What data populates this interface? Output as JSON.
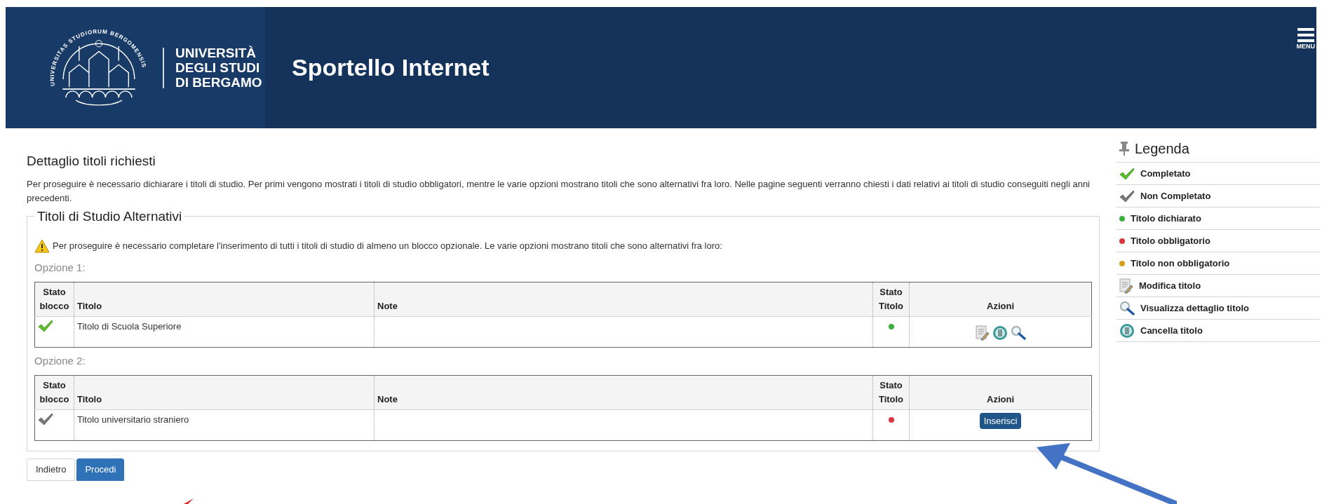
{
  "header": {
    "logo_lines": [
      "UNIVERSITÀ",
      "DEGLI STUDI",
      "DI BERGAMO"
    ],
    "seal_text": "UNIVERSITAS STUDIORUM BERGOMENSIS",
    "title": "Sportello Internet",
    "menu_label": "MENU"
  },
  "page": {
    "title": "Dettaglio titoli richiesti",
    "intro": "Per proseguire è necessario dichiarare i titoli di studio. Per primi vengono mostrati i titoli di studio obbligatori, mentre le varie opzioni mostrano titoli che sono alternativi fra loro. Nelle pagine seguenti verranno chiesti i dati relativi ai titoli di studio conseguiti negli anni precedenti."
  },
  "fieldset": {
    "legend": "Titoli di Studio Alternativi",
    "warning": "Per proseguire è necessario completare l'inserimento di tutti i titoli di studio di almeno un blocco opzionale. Le varie opzioni mostrano titoli che sono alternativi fra loro:",
    "options": [
      {
        "label": "Opzione 1:",
        "columns": [
          "Stato blocco",
          "Titolo",
          "Note",
          "Stato Titolo",
          "Azioni"
        ],
        "rows": [
          {
            "completed": true,
            "title": "Titolo di Scuola Superiore",
            "color": "#3cb043",
            "kind": "icons"
          }
        ]
      },
      {
        "label": "Opzione 2:",
        "columns": [
          "Stato blocco",
          "Titolo",
          "Note",
          "Stato Titolo",
          "Azioni"
        ],
        "rows": [
          {
            "completed": false,
            "title": "Titolo universitario straniero",
            "color": "#d9363e",
            "kind": "insert",
            "button": "Inserisci"
          }
        ]
      }
    ]
  },
  "buttons": [
    {
      "label": "Indietro",
      "kind": "secondary"
    },
    {
      "label": "Procedi",
      "kind": "primary"
    }
  ],
  "legend": {
    "title": "Legenda",
    "items": [
      {
        "kind": "check",
        "checked": true,
        "label": "Completato"
      },
      {
        "kind": "check",
        "checked": false,
        "label": "Non Completato"
      },
      {
        "kind": "dot",
        "color": "#3cb043",
        "label": "Titolo dichiarato"
      },
      {
        "kind": "dot",
        "color": "#d9363e",
        "label": "Titolo obbligatorio"
      },
      {
        "kind": "dot",
        "color": "#d4a017",
        "label": "Titolo non obbligatorio"
      },
      {
        "kind": "edit",
        "label": "Modifica titolo"
      },
      {
        "kind": "search",
        "label": "Visualizza dettaglio titolo"
      },
      {
        "kind": "delete",
        "label": "Cancella titolo"
      }
    ]
  }
}
